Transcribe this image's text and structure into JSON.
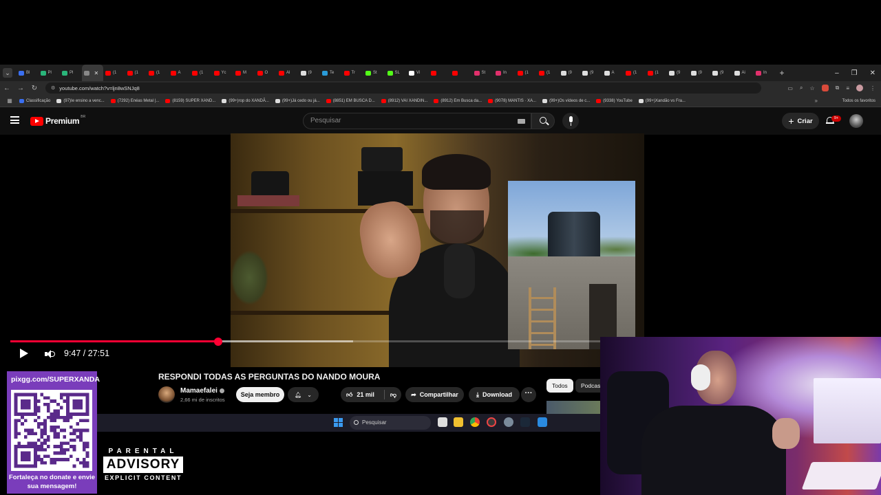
{
  "browser": {
    "tabs": [
      {
        "label": "Bl",
        "color": "#3a6ff0"
      },
      {
        "label": "Pl",
        "color": "#2ab57a"
      },
      {
        "label": "Pl",
        "color": "#2ab57a"
      },
      {
        "label": "",
        "color": "#888888",
        "active": true
      },
      {
        "label": "(1",
        "color": "#ff0000"
      },
      {
        "label": "(1",
        "color": "#ff0000"
      },
      {
        "label": "(1",
        "color": "#ff0000"
      },
      {
        "label": "A",
        "color": "#ff0000"
      },
      {
        "label": "(1",
        "color": "#ff0000"
      },
      {
        "label": "Yc",
        "color": "#ff0000"
      },
      {
        "label": "M",
        "color": "#ff0000"
      },
      {
        "label": "O",
        "color": "#ff0000"
      },
      {
        "label": "Al",
        "color": "#ff0000"
      },
      {
        "label": "(9",
        "color": "#dddddd"
      },
      {
        "label": "Te",
        "color": "#2a9bd8"
      },
      {
        "label": "Tr",
        "color": "#ff0000"
      },
      {
        "label": "St",
        "color": "#53fc18"
      },
      {
        "label": "SL",
        "color": "#53fc18"
      },
      {
        "label": "Vi",
        "color": "#ffffff"
      },
      {
        "label": "",
        "color": "#ff0000"
      },
      {
        "label": "",
        "color": "#ff0000"
      },
      {
        "label": "St",
        "color": "#e1306c"
      },
      {
        "label": "In",
        "color": "#e1306c"
      },
      {
        "label": "(1",
        "color": "#ff0000"
      },
      {
        "label": "(1",
        "color": "#ff0000"
      },
      {
        "label": "(9",
        "color": "#dddddd"
      },
      {
        "label": "(9",
        "color": "#dddddd"
      },
      {
        "label": "A",
        "color": "#dddddd"
      },
      {
        "label": "(1",
        "color": "#ff0000"
      },
      {
        "label": "(1",
        "color": "#ff0000"
      },
      {
        "label": "(9",
        "color": "#dddddd"
      },
      {
        "label": "(9",
        "color": "#dddddd"
      },
      {
        "label": "(9",
        "color": "#dddddd"
      },
      {
        "label": "Ai",
        "color": "#dddddd"
      },
      {
        "label": "In",
        "color": "#e1306c"
      }
    ],
    "new_tab": "+",
    "window_controls": {
      "minimize": "–",
      "maximize": "❐",
      "close": "✕"
    },
    "url": "youtube.com/watch?v=ljn8wSNJq8",
    "bookmarks": [
      {
        "label": "Classificação",
        "color": "#3a6ff0"
      },
      {
        "label": "(97)Ie ensino a venc...",
        "color": "#dddddd"
      },
      {
        "label": "(7292) Enéas Metal |...",
        "color": "#ff0000"
      },
      {
        "label": "(8159) SUPER XAND...",
        "color": "#ff0000"
      },
      {
        "label": "(99+)rop do XANDÃ...",
        "color": "#dddddd"
      },
      {
        "label": "(99+)Já cedo ou já...",
        "color": "#dddddd"
      },
      {
        "label": "(8851) EM BUSCA D...",
        "color": "#ff0000"
      },
      {
        "label": "(8912) VAI XANDIN...",
        "color": "#ff0000"
      },
      {
        "label": "(8912) Em Busca da...",
        "color": "#ff0000"
      },
      {
        "label": "(9078) MANTIS · XA...",
        "color": "#ff0000"
      },
      {
        "label": "(99+)Os vídeos de c...",
        "color": "#dddddd"
      },
      {
        "label": "(9338) YouTube",
        "color": "#ff0000"
      },
      {
        "label": "(99+)Xandão vs Fra...",
        "color": "#dddddd"
      }
    ],
    "bookmarks_more": "»",
    "all_bookmarks": "Todos os favoritos"
  },
  "youtube": {
    "brand": "Premium",
    "country": "BR",
    "search_placeholder": "Pesquisar",
    "create_label": "Criar",
    "notifications_badge": "9+",
    "video": {
      "title": "RESPONDI TODAS AS PERGUNTAS DO NANDO MOURA",
      "time": "9:47 / 27:51",
      "progress": 0.3522,
      "buffered": 0.58
    },
    "channel": {
      "name": "Mamaefalei",
      "subs": "2,66 mi de inscritos"
    },
    "join_label": "Seja membro",
    "likes": "21 mil",
    "share_label": "Compartilhar",
    "download_label": "Download",
    "chips": [
      "Todos",
      "Podcas"
    ]
  },
  "taskbar": {
    "search_placeholder": "Pesquisar"
  },
  "overlay": {
    "donate_url": "pixgg.com/SUPERXANDA",
    "donate_message": "Fortaleça no donate e envie sua mensagem!",
    "parental_advisory": {
      "top": "PARENTAL",
      "middle": "ADVISORY",
      "bottom": "EXPLICIT CONTENT"
    }
  }
}
